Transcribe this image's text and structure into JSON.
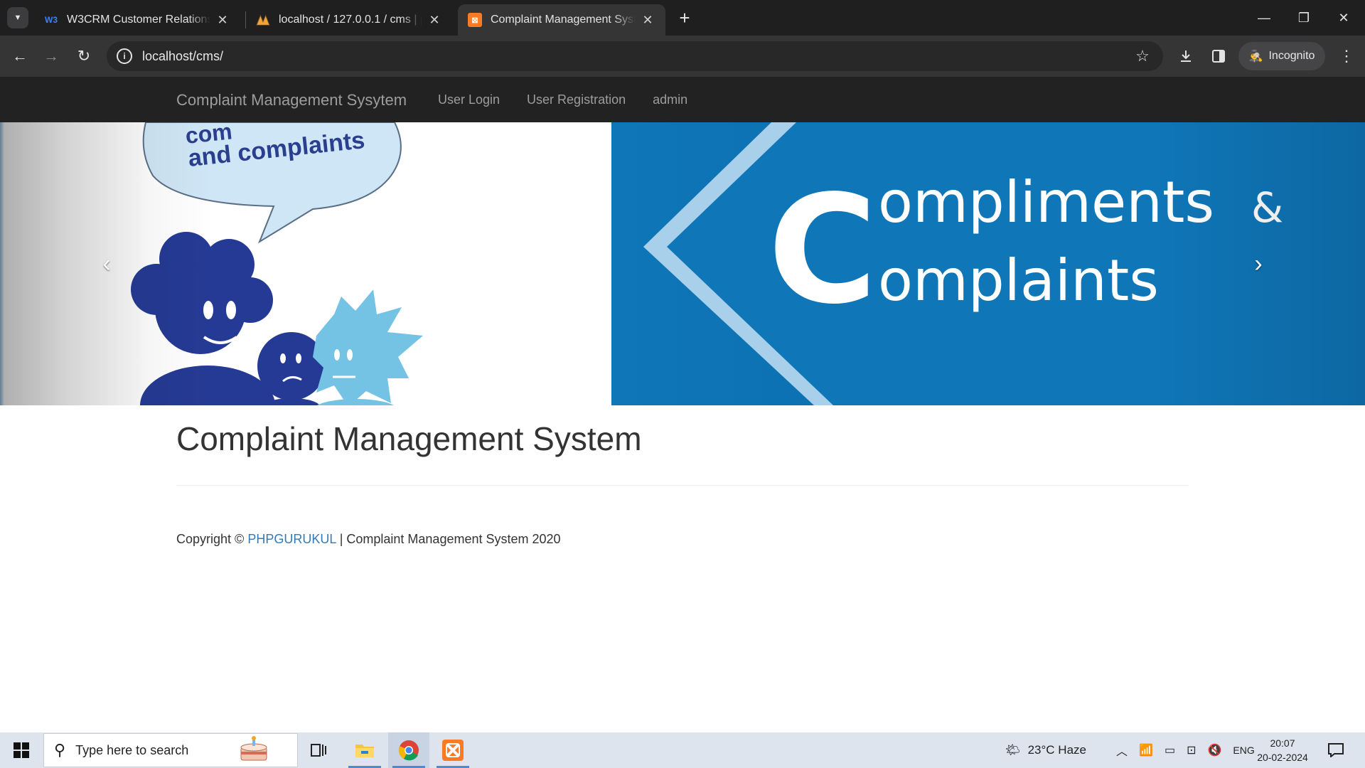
{
  "browser": {
    "tabs": [
      {
        "title": "W3CRM Customer Relationship",
        "favicon": "W3"
      },
      {
        "title": "localhost / 127.0.0.1 / cms | php",
        "favicon": "PMA"
      },
      {
        "title": "Complaint Management System",
        "favicon": "XA"
      }
    ],
    "url": "localhost/cms/",
    "incognito_label": "Incognito"
  },
  "site": {
    "brand": "Complaint Management Sysytem",
    "nav": [
      "User Login",
      "User Registration",
      "admin"
    ],
    "banner": {
      "bubble_text_1": "com",
      "bubble_text_2": "and complaints",
      "big_letter": "C",
      "line1": "ompliments",
      "amp": "&",
      "line2": "omplaints"
    },
    "carousel_prev": "‹",
    "carousel_next": "›",
    "page_title": "Complaint Management System",
    "footer": {
      "prefix": "Copyright ©",
      "link": "PHPGURUKUL",
      "suffix": "| Complaint Management System 2020"
    }
  },
  "taskbar": {
    "search_placeholder": "Type here to search",
    "weather": "23°C  Haze",
    "language": "ENG",
    "time": "20:07",
    "date": "20-02-2024"
  },
  "colors": {
    "navbar": "#222222",
    "banner_blue": "#0f76b8",
    "link": "#337ab7"
  }
}
